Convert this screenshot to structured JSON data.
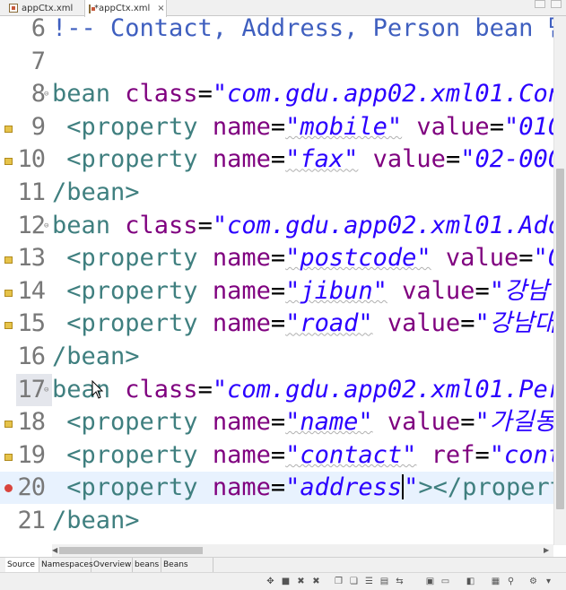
{
  "tabs": [
    {
      "label": "appCtx.xml",
      "close": "×"
    },
    {
      "label": "*appCtx.xml",
      "close": "×"
    }
  ],
  "editor": {
    "lines": [
      {
        "num": "6",
        "segments": [
          {
            "c": "cmt",
            "t": "!-- Contact, Address, Person bean 만"
          }
        ]
      },
      {
        "num": "7",
        "segments": []
      },
      {
        "num": "8",
        "fold": true,
        "segments": [
          {
            "c": "tag",
            "t": "bean "
          },
          {
            "c": "attr",
            "t": "class"
          },
          {
            "c": "eq",
            "t": "="
          },
          {
            "c": "str",
            "t": "\"com.gdu.app02.xml01.Con"
          }
        ]
      },
      {
        "num": "9",
        "marker": "warn",
        "segments": [
          {
            "c": "tag",
            "t": " <property "
          },
          {
            "c": "attr",
            "t": "name"
          },
          {
            "c": "eq",
            "t": "="
          },
          {
            "c": "str wavy",
            "t": "\"mobile\""
          },
          {
            "c": "attr",
            "t": " value"
          },
          {
            "c": "eq",
            "t": "="
          },
          {
            "c": "str",
            "t": "\"010"
          }
        ]
      },
      {
        "num": "10",
        "marker": "warn",
        "segments": [
          {
            "c": "tag",
            "t": " <property "
          },
          {
            "c": "attr",
            "t": "name"
          },
          {
            "c": "eq",
            "t": "="
          },
          {
            "c": "str wavy",
            "t": "\"fax\""
          },
          {
            "c": "attr",
            "t": " value"
          },
          {
            "c": "eq",
            "t": "="
          },
          {
            "c": "str",
            "t": "\"02-000"
          }
        ]
      },
      {
        "num": "11",
        "segments": [
          {
            "c": "tag",
            "t": "/bean>"
          }
        ]
      },
      {
        "num": "12",
        "fold": true,
        "segments": [
          {
            "c": "tag",
            "t": "bean "
          },
          {
            "c": "attr",
            "t": "class"
          },
          {
            "c": "eq",
            "t": "="
          },
          {
            "c": "str",
            "t": "\"com.gdu.app02.xml01.Add"
          }
        ]
      },
      {
        "num": "13",
        "marker": "warn",
        "segments": [
          {
            "c": "tag",
            "t": " <property "
          },
          {
            "c": "attr",
            "t": "name"
          },
          {
            "c": "eq",
            "t": "="
          },
          {
            "c": "str wavy",
            "t": "\"postcode\""
          },
          {
            "c": "attr",
            "t": " value"
          },
          {
            "c": "eq",
            "t": "="
          },
          {
            "c": "str",
            "t": "\"0"
          }
        ]
      },
      {
        "num": "14",
        "marker": "warn",
        "segments": [
          {
            "c": "tag",
            "t": " <property "
          },
          {
            "c": "attr",
            "t": "name"
          },
          {
            "c": "eq",
            "t": "="
          },
          {
            "c": "str wavy",
            "t": "\"jibun\""
          },
          {
            "c": "attr",
            "t": " value"
          },
          {
            "c": "eq",
            "t": "="
          },
          {
            "c": "str",
            "t": "\"강남"
          }
        ]
      },
      {
        "num": "15",
        "marker": "warn",
        "segments": [
          {
            "c": "tag",
            "t": " <property "
          },
          {
            "c": "attr",
            "t": "name"
          },
          {
            "c": "eq",
            "t": "="
          },
          {
            "c": "str wavy",
            "t": "\"road\""
          },
          {
            "c": "attr",
            "t": " value"
          },
          {
            "c": "eq",
            "t": "="
          },
          {
            "c": "str",
            "t": "\"강남대"
          }
        ]
      },
      {
        "num": "16",
        "segments": [
          {
            "c": "tag",
            "t": "/bean>"
          }
        ]
      },
      {
        "num": "17",
        "fold": true,
        "hl": true,
        "segments": [
          {
            "c": "tag",
            "t": "bean "
          },
          {
            "c": "attr",
            "t": "class"
          },
          {
            "c": "eq",
            "t": "="
          },
          {
            "c": "str",
            "t": "\"com.gdu.app02.xml01.Per"
          }
        ]
      },
      {
        "num": "18",
        "marker": "warn",
        "segments": [
          {
            "c": "tag",
            "t": " <property "
          },
          {
            "c": "attr",
            "t": "name"
          },
          {
            "c": "eq",
            "t": "="
          },
          {
            "c": "str wavy",
            "t": "\"name\""
          },
          {
            "c": "attr",
            "t": " value"
          },
          {
            "c": "eq",
            "t": "="
          },
          {
            "c": "str",
            "t": "\"가길동"
          }
        ]
      },
      {
        "num": "19",
        "marker": "warn",
        "segments": [
          {
            "c": "tag",
            "t": " <property "
          },
          {
            "c": "attr",
            "t": "name"
          },
          {
            "c": "eq",
            "t": "="
          },
          {
            "c": "str wavy",
            "t": "\"contact\""
          },
          {
            "c": "attr",
            "t": " ref"
          },
          {
            "c": "eq",
            "t": "="
          },
          {
            "c": "str",
            "t": "\"cont"
          }
        ]
      },
      {
        "num": "20",
        "marker": "err",
        "current": true,
        "segments": [
          {
            "c": "tag",
            "t": " <property "
          },
          {
            "c": "attr",
            "t": "name"
          },
          {
            "c": "eq",
            "t": "="
          },
          {
            "c": "str",
            "t": "\"address"
          },
          {
            "c": "caret",
            "t": ""
          },
          {
            "c": "str",
            "t": "\""
          },
          {
            "c": "tag",
            "t": "></propert"
          }
        ]
      },
      {
        "num": "21",
        "segments": [
          {
            "c": "tag",
            "t": "/bean>"
          }
        ]
      }
    ]
  },
  "bottom_tabs": [
    "Source",
    "Namespaces",
    "Overview",
    "beans",
    "Beans Graph"
  ],
  "colors": {
    "tag": "#3f7f7f",
    "attr": "#7f007f",
    "string": "#2a00ff",
    "comment": "#3f5fbf",
    "current_line": "#e8f2fe"
  }
}
